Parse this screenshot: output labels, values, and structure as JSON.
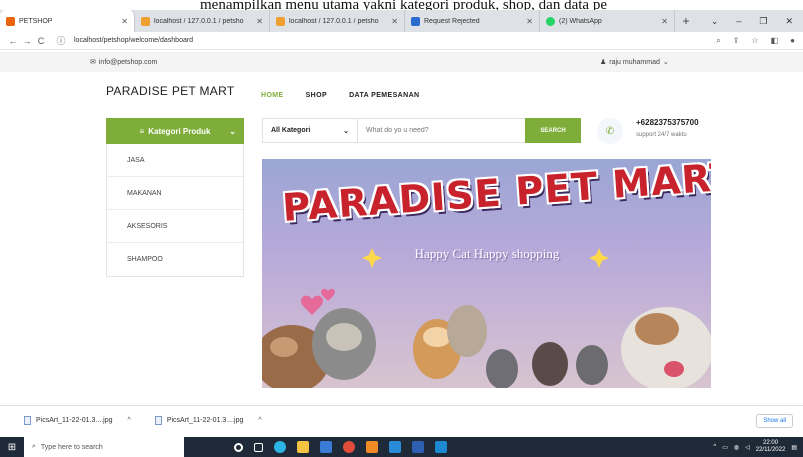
{
  "caption_text": "menampilkan menu utama yakni kategori produk, shop, dan data pe",
  "browser": {
    "tabs": [
      {
        "title": "PETSHOP",
        "color": "#e8650c",
        "active": true
      },
      {
        "title": "localhost / 127.0.0.1 / petsho",
        "color": "#f0a030"
      },
      {
        "title": "localhost / 127.0.0.1 / petsho",
        "color": "#f0a030"
      },
      {
        "title": "Request Rejected",
        "color": "#2a6bd1"
      },
      {
        "title": "(2) WhatsApp",
        "color": "#25d366"
      }
    ],
    "url": "localhost/petshop/welcome/dashboard"
  },
  "infobar": {
    "email": "info@petshop.com",
    "user": "raju muhammad"
  },
  "site": {
    "logo": "PARADISE PET MART",
    "menu": [
      "HOME",
      "SHOP",
      "DATA PEMESANAN"
    ]
  },
  "categories": {
    "header": "Kategori Produk",
    "items": [
      "JASA",
      "MAKANAN",
      "AKSESORIS",
      "SHAMPOO"
    ]
  },
  "search": {
    "category": "All Kategori",
    "placeholder": "What do yo u need?",
    "button": "SEARCH"
  },
  "contact": {
    "phone": "+6282375375700",
    "support": "support 24/7 waktu"
  },
  "banner": {
    "title": "PARADISE PET MART",
    "subtitle": "Happy Cat Happy shopping"
  },
  "downloads": {
    "files": [
      "PicsArt_11-22-01.3....jpg",
      "PicsArt_11-22-01.3....jpg"
    ],
    "show_all": "Show all"
  },
  "taskbar": {
    "search_placeholder": "Type here to search",
    "time": "22:00",
    "date": "22/11/2022"
  },
  "colors": {
    "brand_green": "#7fad39",
    "banner_title": "#c8232c"
  }
}
